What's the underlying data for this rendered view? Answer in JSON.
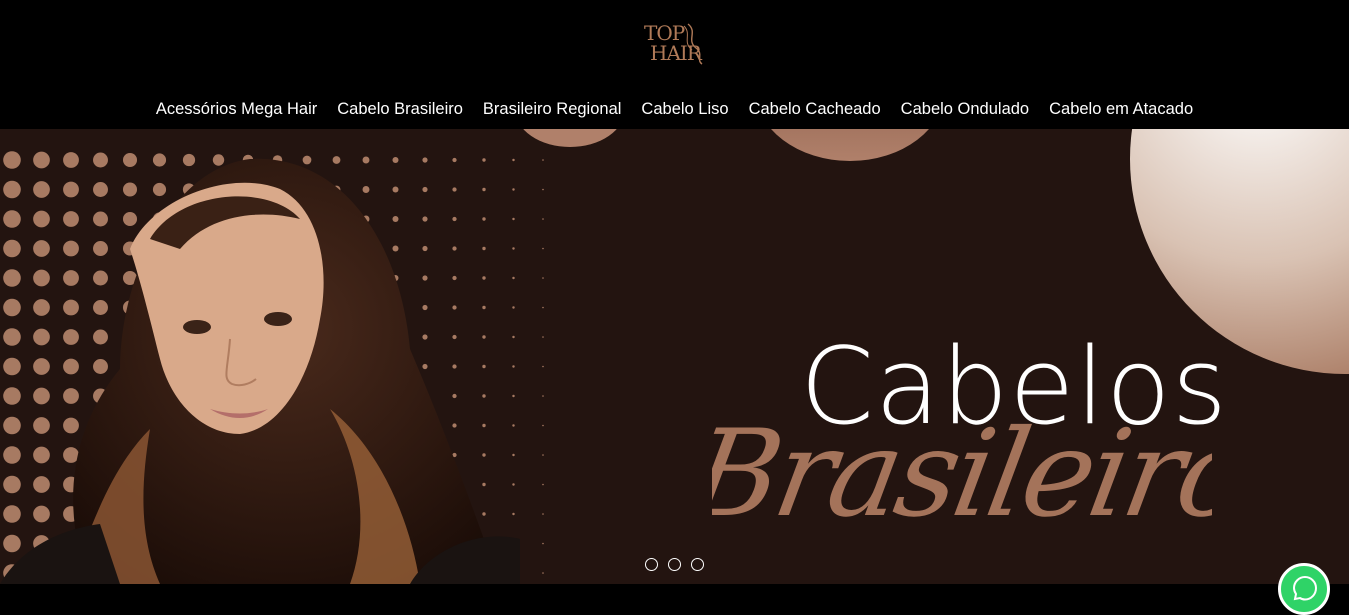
{
  "brand": {
    "logo_text_top": "TOP",
    "logo_text_bottom": "HAIR",
    "logo_color": "#b07a58"
  },
  "nav": {
    "items": [
      {
        "label": "Acessórios Mega Hair"
      },
      {
        "label": "Cabelo Brasileiro"
      },
      {
        "label": "Brasileiro Regional"
      },
      {
        "label": "Cabelo Liso"
      },
      {
        "label": "Cabelo Cacheado"
      },
      {
        "label": "Cabelo Ondulado"
      },
      {
        "label": "Cabelo em Atacado"
      }
    ]
  },
  "hero": {
    "title": "Cabelos",
    "script_text": "Brasileiros",
    "background_color": "#231410",
    "accent_color": "#a4735a",
    "slides": 3
  },
  "widgets": {
    "whatsapp_icon": "whatsapp-icon"
  }
}
